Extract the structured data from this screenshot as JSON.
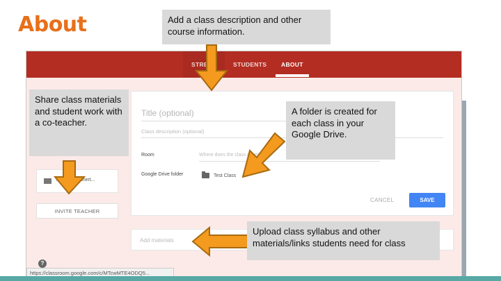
{
  "slide": {
    "title": "About"
  },
  "tabs": {
    "stream": "STRE",
    "students": "STUDENTS",
    "about": "ABOUT"
  },
  "left_panel": {
    "card_text": "inst...  ...teachert...",
    "invite_button": "INVITE TEACHER"
  },
  "form": {
    "title_placeholder": "Title (optional)",
    "description_placeholder": "Class description (optional)",
    "room_label": "Room",
    "room_placeholder": "Where does the class meet?",
    "drive_label": "Google Drive folder",
    "drive_folder_name": "Test Class",
    "cancel": "CANCEL",
    "save": "SAVE"
  },
  "materials": {
    "placeholder": "Add materials"
  },
  "help": {
    "icon_text": "?"
  },
  "status_bar": {
    "url": "https://classroom.google.com/c/MTcwMTE4ODQ5..."
  },
  "callouts": {
    "top": "Add a class description and other course information.",
    "left": "Share class materials and student work with a co-teacher.",
    "right": "A folder is created for each class in your Google Drive.",
    "bottom": "Upload class syllabus and other materials/links students need for class"
  },
  "colors": {
    "title_orange": "#e8701a",
    "topbar_red": "#b32d22",
    "arrow_orange": "#f39a1f",
    "arrow_outline": "#a86a10",
    "callout_gray": "#d9d9d9",
    "save_blue": "#4285f4"
  }
}
